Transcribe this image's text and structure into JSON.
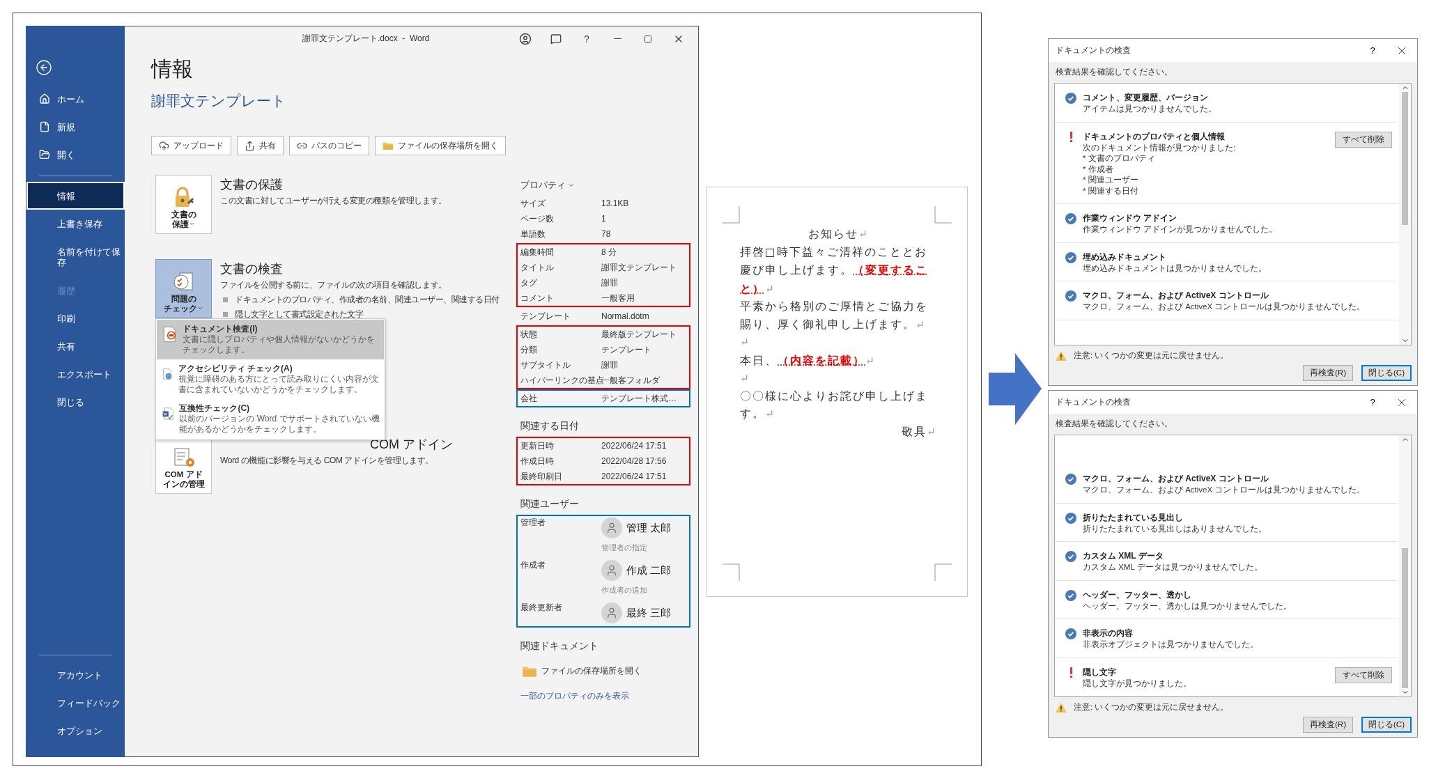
{
  "word_window": {
    "title": "謝罪文テンプレート.docx  -  Word",
    "title_controls": [
      {
        "kind": "account"
      },
      {
        "kind": "feedback"
      },
      {
        "kind": "help",
        "label": "?"
      },
      {
        "kind": "minimize"
      },
      {
        "kind": "maximize"
      },
      {
        "kind": "close"
      }
    ],
    "sidebar": {
      "top": [
        {
          "label": "ホーム",
          "selected": false,
          "disabled": false
        },
        {
          "label": "新規",
          "selected": false,
          "disabled": false
        },
        {
          "label": "開く",
          "selected": false,
          "disabled": false
        }
      ],
      "main": [
        {
          "label": "情報",
          "selected": true,
          "disabled": false
        },
        {
          "label": "上書き保存",
          "selected": false,
          "disabled": false
        },
        {
          "label": "名前を付けて保存",
          "selected": false,
          "disabled": false
        },
        {
          "label": "履歴",
          "selected": false,
          "disabled": true
        },
        {
          "label": "印刷",
          "selected": false,
          "disabled": false
        },
        {
          "label": "共有",
          "selected": false,
          "disabled": false
        },
        {
          "label": "エクスポート",
          "selected": false,
          "disabled": false
        },
        {
          "label": "閉じる",
          "selected": false,
          "disabled": false
        }
      ],
      "bottom": [
        {
          "label": "アカウント",
          "selected": false,
          "disabled": false
        },
        {
          "label": "フィードバック",
          "selected": false,
          "disabled": false
        },
        {
          "label": "オプション",
          "selected": false,
          "disabled": false
        }
      ]
    },
    "heading": "情報",
    "document_title": "謝罪文テンプレート",
    "actions": [
      {
        "label": "アップロード"
      },
      {
        "label": "共有"
      },
      {
        "label": "パスのコピー"
      },
      {
        "label": "ファイルの保存場所を開く"
      }
    ],
    "sections": [
      {
        "tile_lines": [
          "文書の",
          "保護"
        ],
        "dropdown": true,
        "selected": false,
        "title": "文書の保護",
        "description": "この文書に対してユーザーが行える変更の種類を管理します。"
      },
      {
        "tile_lines": [
          "問題の",
          "チェック"
        ],
        "dropdown": true,
        "selected": true,
        "title": "文書の検査",
        "description": "ファイルを公開する前に、ファイルの次の項目を確認します。",
        "bullets": [
          "ドキュメントのプロパティ、作成者の名前、関連ユーザー、関連する日付",
          "隠し文字として書式設定された文字"
        ],
        "menu": [
          {
            "title": "ドキュメント検査(I)",
            "description": "文書に隠しプロパティや個人情報がないかどうかをチェックします。",
            "selected": true
          },
          {
            "title": "アクセシビリティ チェック(A)",
            "description": "視覚に障碍のある方にとって読み取りにくい内容が文書に含まれていないかどうかをチェックします。",
            "selected": false
          },
          {
            "title": "互換性チェック(C)",
            "description": "以前のバージョンの Word でサポートされていない機能があるかどうかをチェックします。",
            "selected": false
          }
        ]
      },
      {
        "tile_lines": [
          "COM アド",
          "インの管理"
        ],
        "dropdown": false,
        "selected": false,
        "title": "COM アドイン",
        "description": "Word の機能に影響を与える COM アドインを管理します。"
      }
    ],
    "properties": {
      "header": "プロパティ",
      "groups": [
        {
          "rows": [
            {
              "label": "サイズ",
              "value": "13.1KB"
            },
            {
              "label": "ページ数",
              "value": "1"
            },
            {
              "label": "単語数",
              "value": "78"
            }
          ]
        },
        {
          "color": "#ee0000",
          "rows": [
            {
              "label": "編集時間",
              "value": "8 分"
            },
            {
              "label": "タイトル",
              "value": "謝罪文テンプレート"
            },
            {
              "label": "タグ",
              "value": "謝罪"
            },
            {
              "label": "コメント",
              "value": "一般客用"
            }
          ]
        },
        {
          "rows": [
            {
              "label": "テンプレート",
              "value": "Normal.dotm"
            }
          ]
        },
        {
          "color": "#ee0000",
          "rows": [
            {
              "label": "状態",
              "value": "最終版テンプレート"
            },
            {
              "label": "分類",
              "value": "テンプレート"
            },
            {
              "label": "サブタイトル",
              "value": "謝罪"
            },
            {
              "label": "ハイパーリンクの基点",
              "value": "一般客フォルダ"
            }
          ]
        },
        {
          "color": "#0070c0",
          "rows": [
            {
              "label": "会社",
              "value": "テンプレート株式…"
            }
          ]
        }
      ],
      "dates_heading": "関連する日付",
      "dates": {
        "color": "#ee0000",
        "rows": [
          {
            "label": "更新日時",
            "value": "2022/06/24 17:51"
          },
          {
            "label": "作成日時",
            "value": "2022/04/28 17:56"
          },
          {
            "label": "最終印刷日",
            "value": "2022/06/24 17:51"
          }
        ]
      },
      "users_heading": "関連ユーザー",
      "users": {
        "color": "#0070c0",
        "rows": [
          {
            "label": "管理者",
            "name": "管理 太郎",
            "hint": "管理者の指定"
          },
          {
            "label": "作成者",
            "name": "作成 二郎",
            "hint": "作成者の追加"
          },
          {
            "label": "最終更新者",
            "name": "最終 三郎"
          }
        ]
      },
      "documents_heading": "関連ドキュメント",
      "open_location": "ファイルの保存場所を開く",
      "show_fewer": "一部のプロパティのみを表示"
    }
  },
  "document_page": {
    "paragraphs": [
      {
        "kind": "title",
        "text": "お知らせ",
        "mark": "↵"
      },
      {
        "kind": "body",
        "text": "拝啓□時下益々ご清祥のこととお慶び申し上げます。**（変更すること）**",
        "mark": "↵"
      },
      {
        "kind": "body",
        "text": "平素から格別のご厚情とご協力を賜り、厚く御礼申し上げます。",
        "mark": "↵"
      },
      {
        "kind": "body",
        "mark": "↵"
      },
      {
        "kind": "body",
        "text": "本日、**（内容を記載）**",
        "mark": "↵"
      },
      {
        "kind": "body",
        "mark": "↵"
      },
      {
        "kind": "body",
        "text": "〇〇様に心よりお詫び申し上げます。",
        "mark": "↵"
      },
      {
        "kind": "closing",
        "text": "敬具",
        "mark": "↵"
      }
    ]
  },
  "dialogs": [
    {
      "title": "ドキュメントの検査",
      "help": "?",
      "prompt": "検査結果を確認してください。",
      "scrolled_to_end": false,
      "results": [
        {
          "found": false,
          "title": "コメント、変更履歴、バージョン",
          "lines": [
            "アイテムは見つかりませんでした。"
          ]
        },
        {
          "found": true,
          "title": "ドキュメントのプロパティと個人情報",
          "lines": [
            "次のドキュメント情報が見つかりました:",
            "* 文書のプロパティ",
            "* 作成者",
            "* 関連ユーザー",
            "* 関連する日付"
          ],
          "action": "すべて削除"
        },
        {
          "found": false,
          "title": "作業ウィンドウ アドイン",
          "lines": [
            "作業ウィンドウ アドインが見つかりませんでした。"
          ]
        },
        {
          "found": false,
          "title": "埋め込みドキュメント",
          "lines": [
            "埋め込みドキュメントは見つかりませんでした。"
          ]
        },
        {
          "found": false,
          "title": "マクロ、フォーム、および ActiveX コントロール",
          "lines": [
            "マクロ、フォーム、および ActiveX コントロールは見つかりませんでした。"
          ]
        }
      ],
      "warning": "注意: いくつかの変更は元に戻せません。",
      "buttons": [
        {
          "label": "再検査(R)",
          "default": false
        },
        {
          "label": "閉じる(C)",
          "default": true
        }
      ]
    },
    {
      "title": "ドキュメントの検査",
      "help": "?",
      "prompt": "検査結果を確認してください。",
      "scrolled_to_end": true,
      "results": [
        {
          "found": false,
          "title": "マクロ、フォーム、および ActiveX コントロール",
          "lines": [
            "マクロ、フォーム、および ActiveX コントロールは見つかりませんでした。"
          ]
        },
        {
          "found": false,
          "title": "折りたたまれている見出し",
          "lines": [
            "折りたたまれている見出しはありませんでした。"
          ]
        },
        {
          "found": false,
          "title": "カスタム XML データ",
          "lines": [
            "カスタム XML データは見つかりませんでした。"
          ]
        },
        {
          "found": false,
          "title": "ヘッダー、フッター、透かし",
          "lines": [
            "ヘッダー、フッター、透かしは見つかりませんでした。"
          ]
        },
        {
          "found": false,
          "title": "非表示の内容",
          "lines": [
            "非表示オブジェクトは見つかりませんでした。"
          ]
        },
        {
          "found": true,
          "title": "隠し文字",
          "lines": [
            "隠し文字が見つかりました。"
          ],
          "action": "すべて削除"
        }
      ],
      "warning": "注意: いくつかの変更は元に戻せません。",
      "buttons": [
        {
          "label": "再検査(R)",
          "default": false
        },
        {
          "label": "閉じる(C)",
          "default": true
        }
      ]
    }
  ]
}
